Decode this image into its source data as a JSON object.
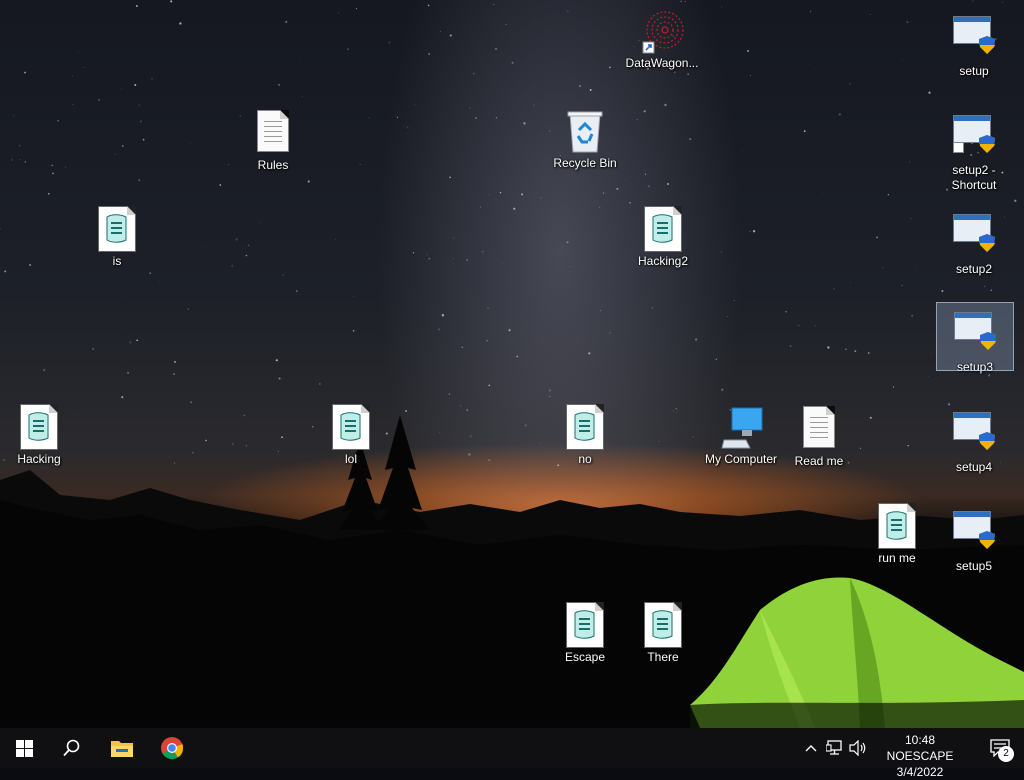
{
  "desktop": {
    "icons": {
      "datawagon": "DataWagon...",
      "setup": "setup",
      "rules": "Rules",
      "recycle_bin": "Recycle Bin",
      "setup2_shortcut": "setup2 - Shortcut",
      "is": "is",
      "hacking2": "Hacking2",
      "setup2": "setup2",
      "setup3": "setup3",
      "hacking": "Hacking",
      "lol": "lol",
      "no": "no",
      "my_computer": "My Computer",
      "read_me": "Read me",
      "setup4": "setup4",
      "run_me": "run me",
      "setup5": "setup5",
      "escape": "Escape",
      "there": "There"
    },
    "selected_icon": "setup3"
  },
  "taskbar": {
    "start_icon": "windows-logo-icon",
    "search_icon": "search-icon",
    "pinned": [
      "file-explorer-icon",
      "chrome-icon"
    ],
    "tray_icons": [
      "chevron-up-icon",
      "network-icon",
      "volume-icon"
    ],
    "clock_time": "10:48 NOESCAPE",
    "clock_date": "3/4/2022",
    "notification_count": "2"
  },
  "colors": {
    "taskbar_bg": "#101012",
    "selection": "#8fa8c8",
    "tent_green": "#8fd23a",
    "sunset_orange": "#dc6e28"
  }
}
